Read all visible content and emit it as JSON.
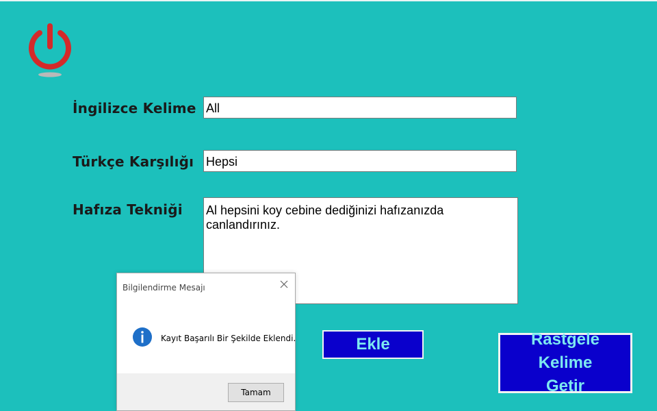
{
  "form": {
    "english_label": "İngilizce Kelime",
    "english_value": "All",
    "turkish_label": "Türkçe Karşılığı",
    "turkish_value": "Hepsi",
    "memory_label": "Hafıza Tekniği",
    "memory_value": "Al hepsini koy cebine dediğinizi hafızanızda canlandırınız."
  },
  "buttons": {
    "add_label": "Ekle",
    "random_line1": "Rastgele Kelime",
    "random_line2": "Getir"
  },
  "dialog": {
    "title": "Bilgilendirme Mesajı",
    "message": "Kayıt Başarılı Bir Şekilde Eklendi.",
    "ok_label": "Tamam"
  },
  "colors": {
    "background": "#1cc0bc",
    "button_fill": "#0a00cc",
    "button_text": "#7de8f0",
    "power_icon": "#d42a2a",
    "info_icon": "#1e6fc8"
  },
  "icons": {
    "power": "power-icon",
    "close": "close-icon",
    "info": "info-icon"
  }
}
